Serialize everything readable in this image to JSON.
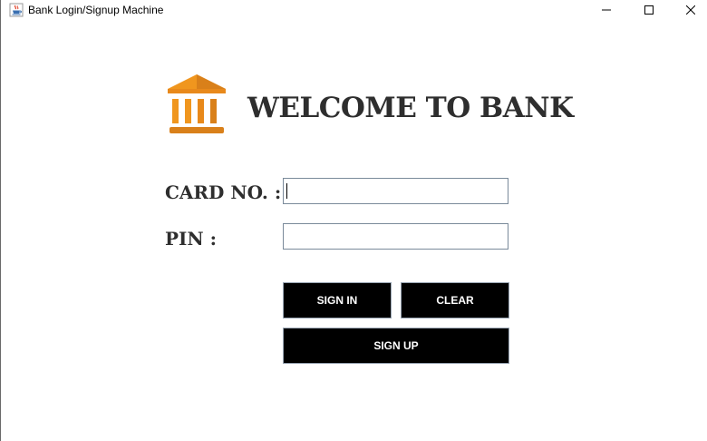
{
  "window": {
    "title": "Bank Login/Signup Machine",
    "icon": "java-cup-icon",
    "controls": [
      "minimize-icon",
      "maximize-icon",
      "close-icon"
    ]
  },
  "header": {
    "icon": "bank-building-icon",
    "title": "WELCOME TO BANK"
  },
  "form": {
    "card_label": "CARD NO. :",
    "card_value": "",
    "pin_label": "PIN :",
    "pin_value": ""
  },
  "buttons": {
    "sign_in": "SIGN IN",
    "clear": "CLEAR",
    "sign_up": "SIGN UP"
  },
  "colors": {
    "icon_orange": "#f0961e",
    "icon_orange_dark": "#d9801a",
    "text_dark": "#2e2e2e",
    "button_bg": "#000000",
    "button_text": "#ffffff"
  }
}
